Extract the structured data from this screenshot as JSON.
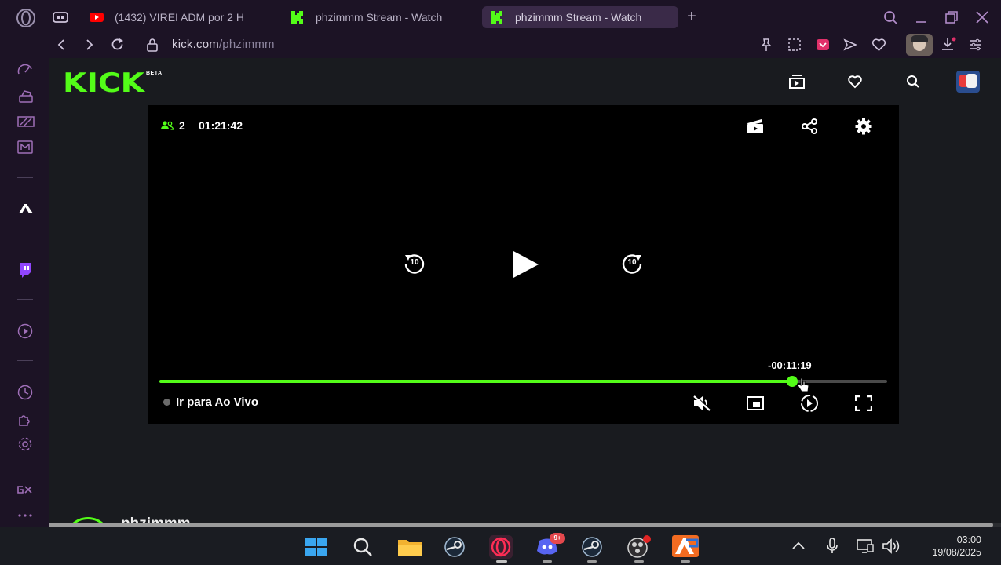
{
  "browser": {
    "tabs": [
      {
        "title": "(1432) VIREI ADM por 2 H",
        "favicon": "youtube-icon"
      },
      {
        "title": "phzimmm Stream - Watch",
        "favicon": "kick-icon"
      },
      {
        "title": "phzimmm Stream - Watch",
        "favicon": "kick-icon",
        "active": true
      }
    ],
    "new_tab_label": "+",
    "url_domain": "kick.com",
    "url_path": "/phzimmm"
  },
  "site": {
    "logo_text": "KICK",
    "beta_label": "BETA",
    "accent_color": "#53fc18"
  },
  "player": {
    "viewer_count": "2",
    "uptime": "01:21:42",
    "remaining": "-00:11:19",
    "progress_fraction": 0.87,
    "go_live_label": "Ir para Ao Vivo",
    "rewind_label": "10",
    "forward_label": "10"
  },
  "channel": {
    "name": "phzimmm"
  },
  "taskbar": {
    "time": "03:00",
    "date": "19/08/2025",
    "discord_badge": "9+"
  }
}
